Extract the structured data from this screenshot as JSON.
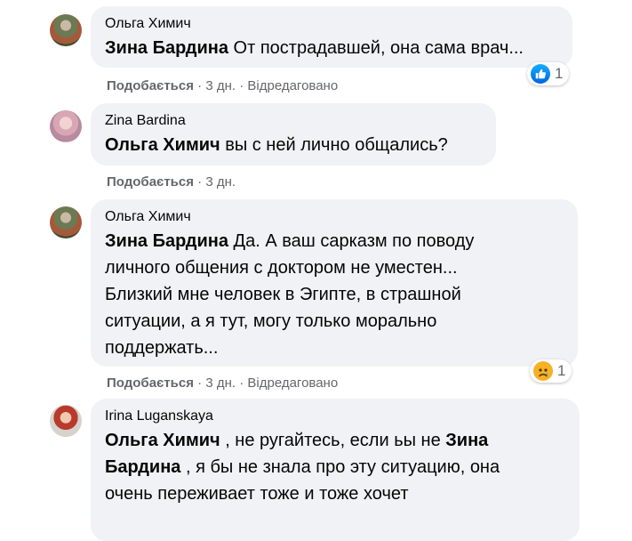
{
  "comments": [
    {
      "author": "Ольга Химич",
      "mention": "Зина Бардина",
      "text": " От пострадавшей, она сама врач...",
      "actions": {
        "like": "Подобається",
        "sep": " · ",
        "time": "3 дн.",
        "edited": "Відредаговано"
      },
      "reaction": {
        "icon": "thumbs-up-icon",
        "count": "1"
      }
    },
    {
      "author": "Zina Bardina",
      "mention": "Ольга Химич",
      "text": " вы с ней лично общались?",
      "actions": {
        "like": "Подобається",
        "sep": " · ",
        "time": "3 дн."
      }
    },
    {
      "author": "Ольга Химич",
      "mention": "Зина Бардина",
      "lines": [
        " Да. А ваш сарказм по поводу",
        "личного общения с доктором не уместен...",
        "Близкий мне человек в Эгипте, в страшной",
        "ситуации, а я тут, могу только морально",
        "поддержать..."
      ],
      "actions": {
        "like": "Подобається",
        "sep": " · ",
        "time": "3 дн.",
        "edited": "Відредаговано"
      },
      "reaction": {
        "icon": "sad-face-icon",
        "count": "1"
      }
    },
    {
      "author": "Irina Luganskaya",
      "mention1": "Ольга Химич",
      "text1": " , не ругайтесь, если ьы не ",
      "mention2a": "Зина",
      "mention2b": "Бардина",
      "text2": " , я бы не знала про эту ситуацию, она",
      "text3": "очень переживает тоже и тоже хочет"
    }
  ]
}
